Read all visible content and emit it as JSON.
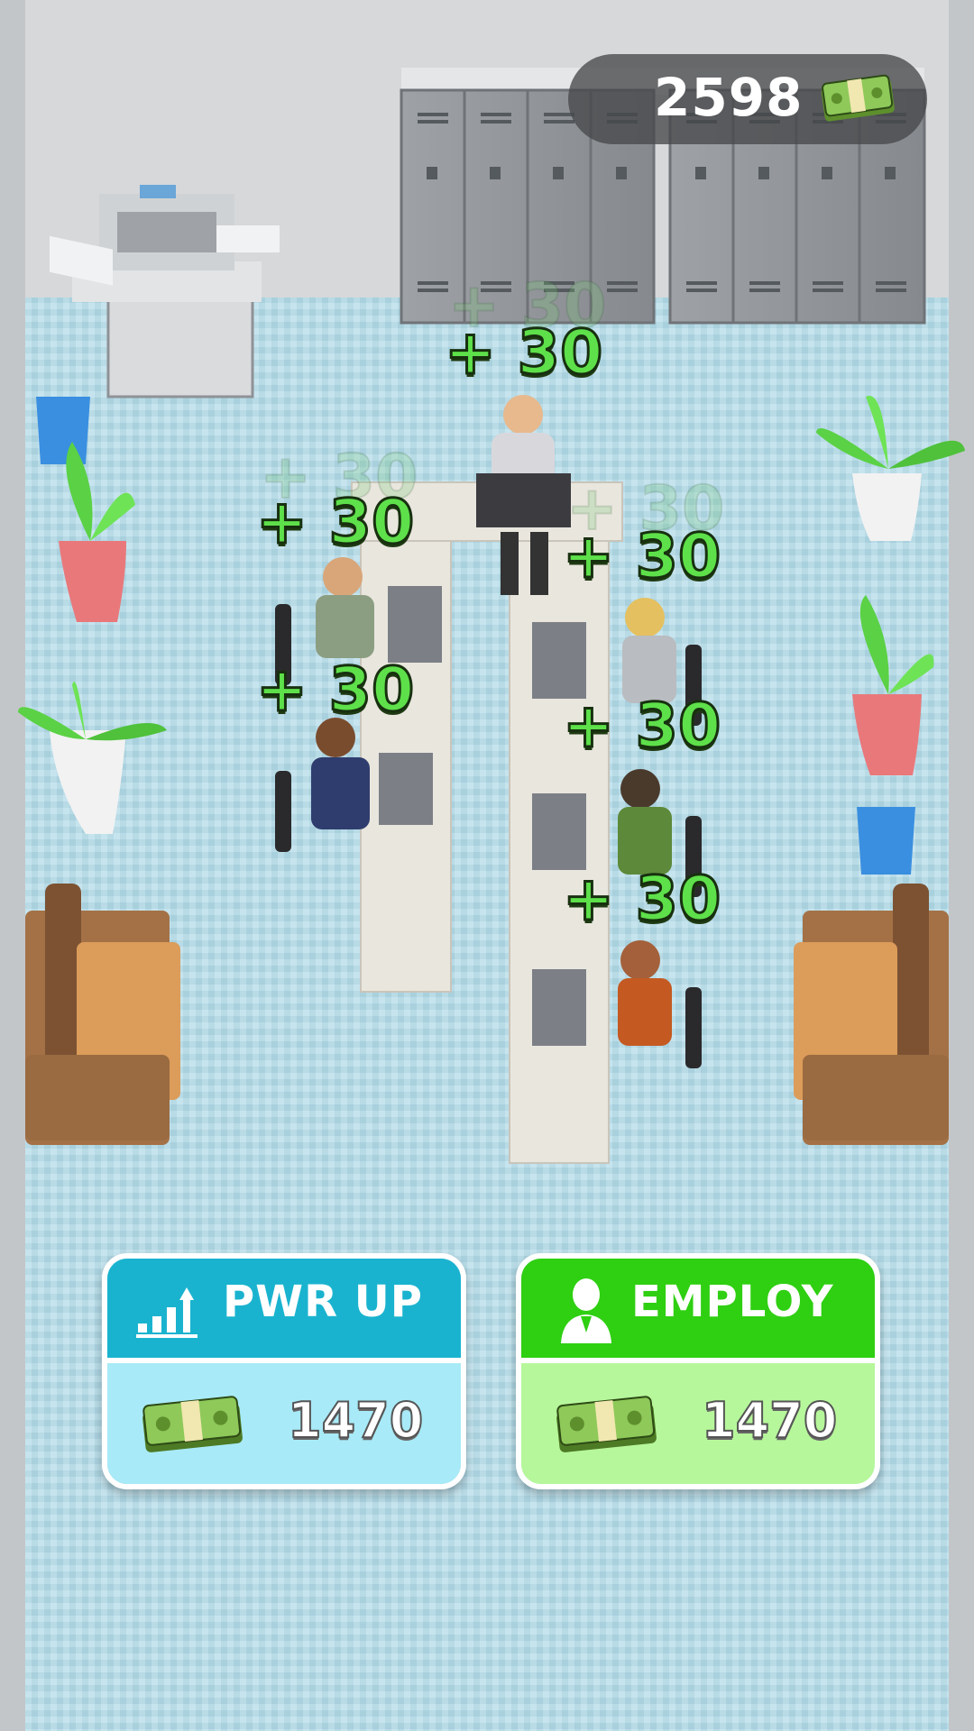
{
  "hud": {
    "currency_amount": "2598",
    "currency_icon": "cash-stack-icon"
  },
  "income_popups": [
    "+ 30",
    "+ 30",
    "+ 30",
    "+ 30",
    "+ 30",
    "+ 30"
  ],
  "buttons": {
    "power_up": {
      "label": "PWR UP",
      "icon": "bar-chart-up-icon",
      "price": "1470",
      "color": "#1ab3cf"
    },
    "employ": {
      "label": "EMPLOY",
      "icon": "employee-icon",
      "price": "1470",
      "color": "#2fcf12"
    }
  },
  "colors": {
    "floor": "#b9dbe6",
    "wall": "#cfd3d6",
    "gain_text": "#5ee04a"
  }
}
